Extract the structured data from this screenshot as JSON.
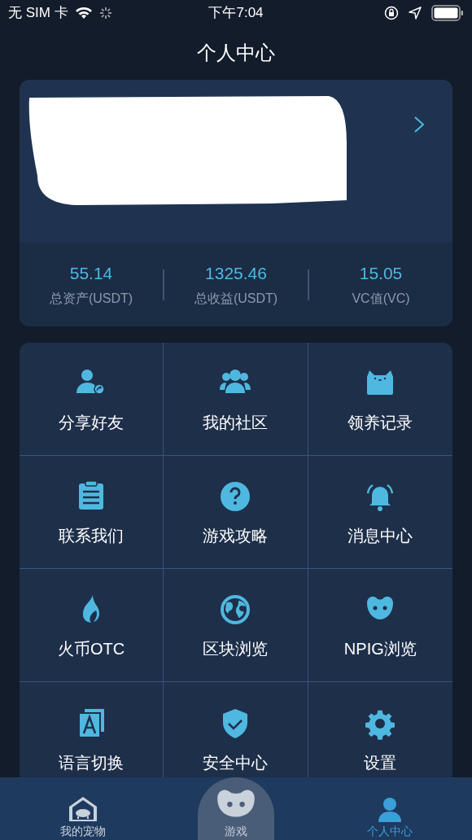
{
  "status_bar": {
    "carrier": "无 SIM 卡",
    "time": "下午7:04"
  },
  "title": "个人中心",
  "stats": [
    {
      "value": "55.14",
      "label": "总资产(USDT)"
    },
    {
      "value": "1325.46",
      "label": "总收益(USDT)"
    },
    {
      "value": "15.05",
      "label": "VC值(VC)"
    }
  ],
  "menu": [
    {
      "label": "分享好友",
      "kind": "share"
    },
    {
      "label": "我的社区",
      "kind": "group"
    },
    {
      "label": "领养记录",
      "kind": "cat"
    },
    {
      "label": "联系我们",
      "kind": "clipboard"
    },
    {
      "label": "游戏攻略",
      "kind": "help"
    },
    {
      "label": "消息中心",
      "kind": "bell"
    },
    {
      "label": "火币OTC",
      "kind": "flame"
    },
    {
      "label": "区块浏览",
      "kind": "globe"
    },
    {
      "label": "NPIG浏览",
      "kind": "mascot"
    },
    {
      "label": "语言切换",
      "kind": "language"
    },
    {
      "label": "安全中心",
      "kind": "shield"
    },
    {
      "label": "设置",
      "kind": "gear"
    }
  ],
  "tab_bar": [
    {
      "label": "我的宠物",
      "kind": "home",
      "selected": false
    },
    {
      "label": "游戏",
      "kind": "game",
      "selected": false
    },
    {
      "label": "个人中心",
      "kind": "person",
      "selected": true
    }
  ]
}
